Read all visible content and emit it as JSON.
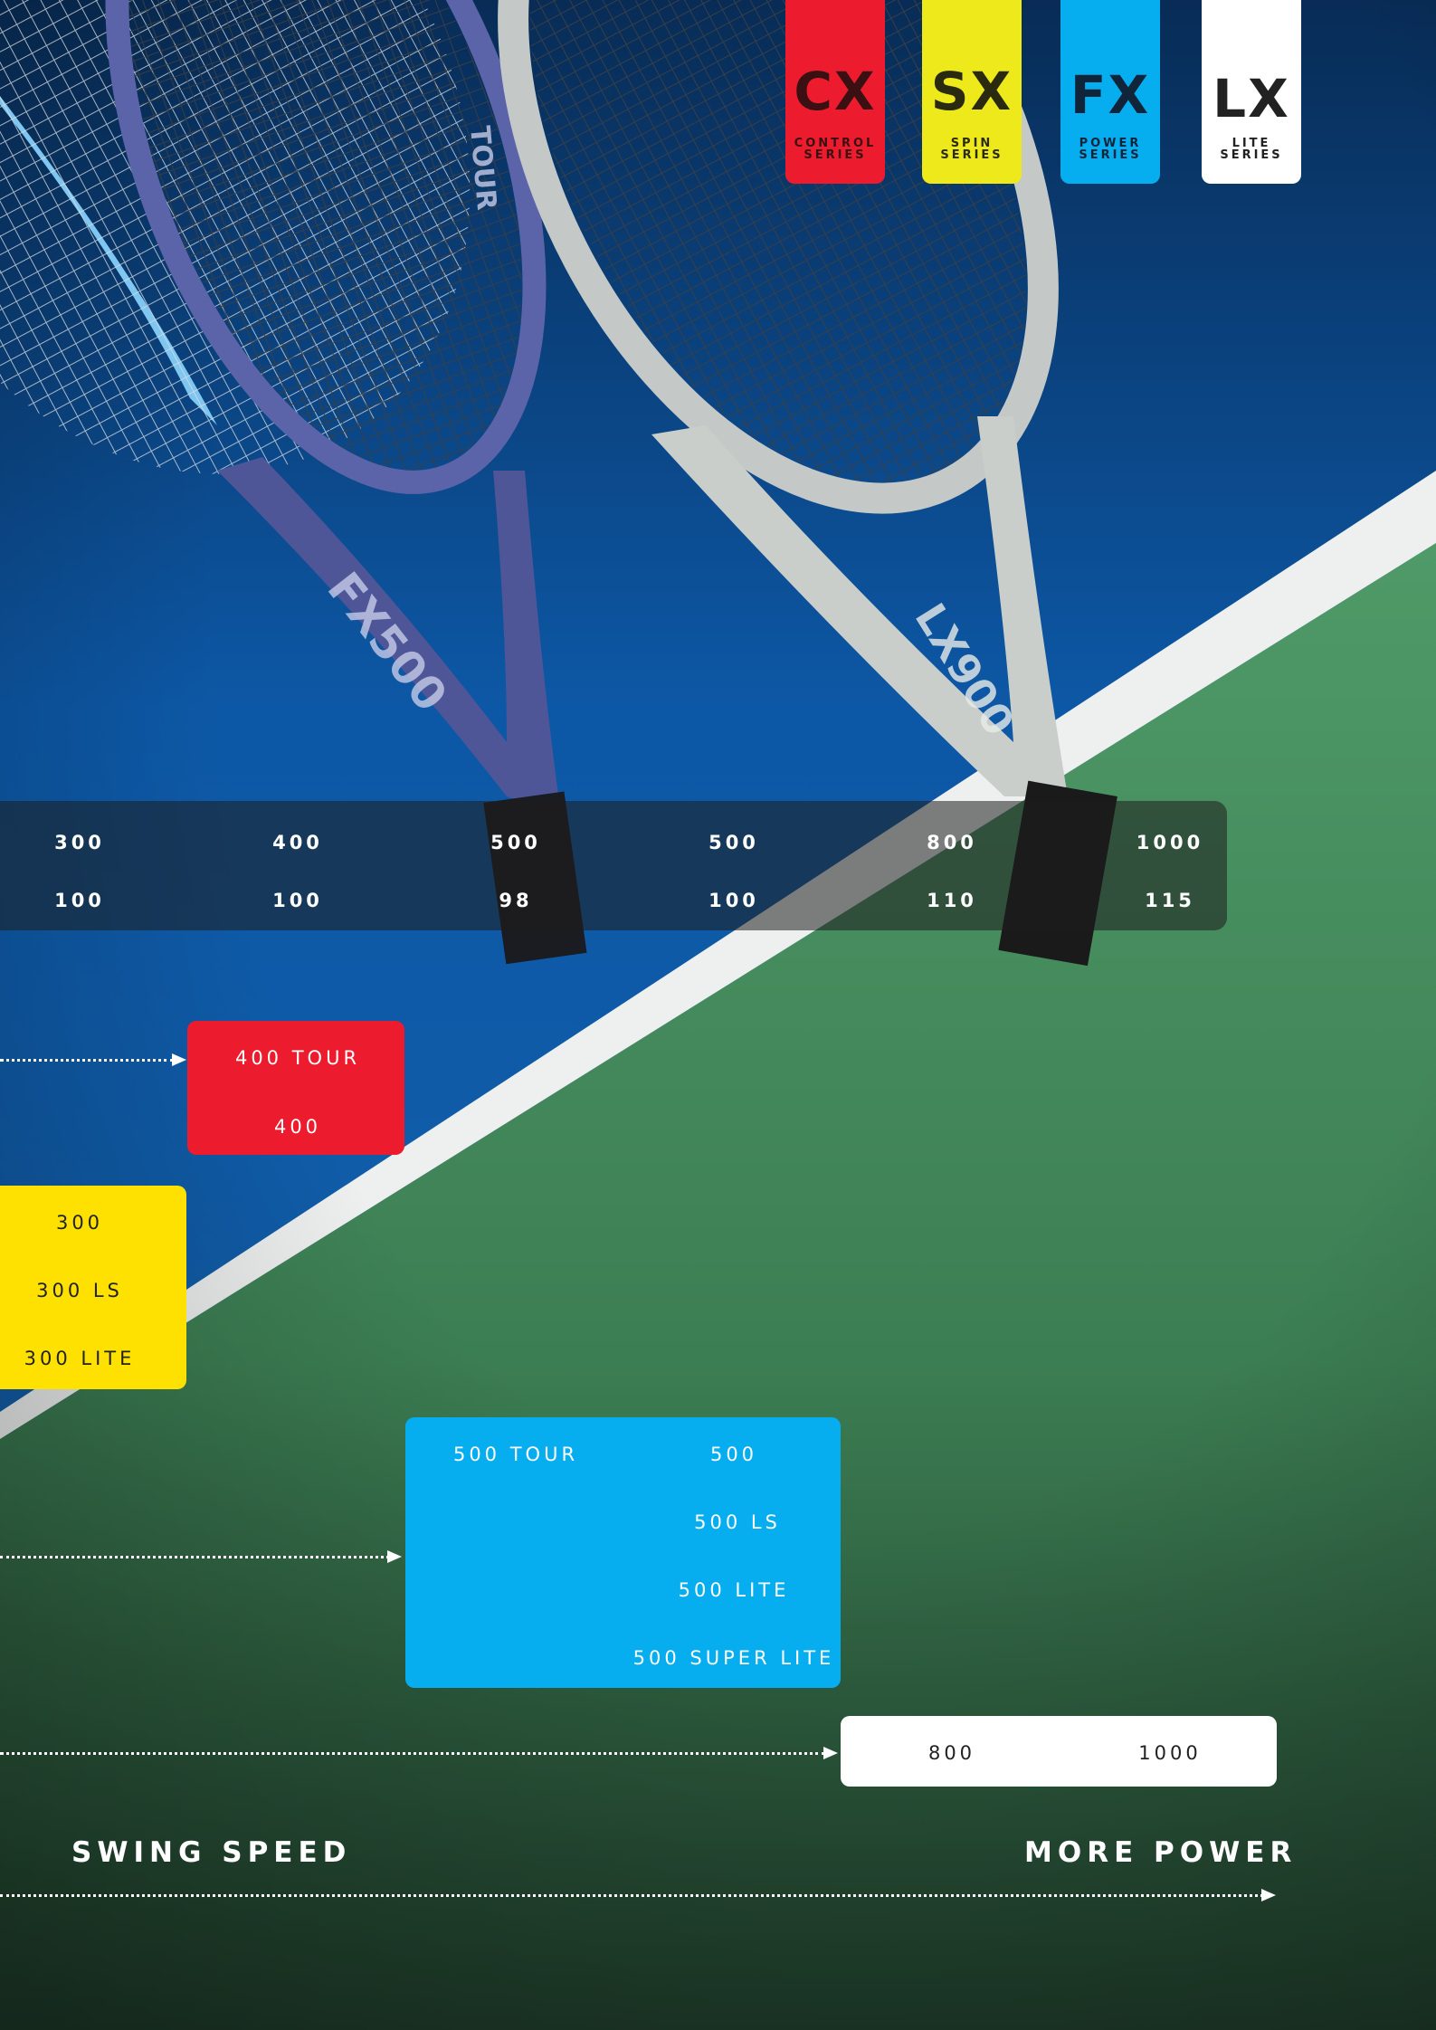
{
  "colors": {
    "control": "#EC1C2E",
    "spin": "#EDE91A",
    "power": "#06AEEF",
    "lite": "#FFFFFF",
    "yellow_box": "#FFE100",
    "court_blue": "#0E5AA7",
    "court_green": "#3E8C5C"
  },
  "series_badges": [
    {
      "code": "CX",
      "line1": "CONTROL",
      "line2": "SERIES",
      "icon": "cx-series-badge"
    },
    {
      "code": "SX",
      "line1": "SPIN",
      "line2": "SERIES",
      "icon": "sx-series-badge"
    },
    {
      "code": "FX",
      "line1": "POWER",
      "line2": "SERIES",
      "icon": "fx-series-badge"
    },
    {
      "code": "LX",
      "line1": "LITE",
      "line2": "SERIES",
      "icon": "lx-series-badge"
    }
  ],
  "racket_graphics": {
    "frame_texts": [
      "FX500",
      "TOUR",
      "LX900"
    ]
  },
  "spec_table": {
    "models": [
      "300",
      "400",
      "500",
      "500",
      "800",
      "1000"
    ],
    "head_sizes": [
      "100",
      "100",
      "98",
      "100",
      "110",
      "115"
    ]
  },
  "rows": {
    "cx": {
      "items": [
        "400 TOUR",
        "400"
      ]
    },
    "sx": {
      "items": [
        "300",
        "300 LS",
        "300 LITE"
      ]
    },
    "fx": {
      "left_items": [
        "500 TOUR"
      ],
      "right_items": [
        "500",
        "500 LS",
        "500 LITE",
        "500 SUPER LITE"
      ]
    },
    "lx": {
      "items": [
        "800",
        "1000"
      ]
    }
  },
  "axis": {
    "left_label": "SWING SPEED",
    "right_label": "MORE POWER"
  }
}
